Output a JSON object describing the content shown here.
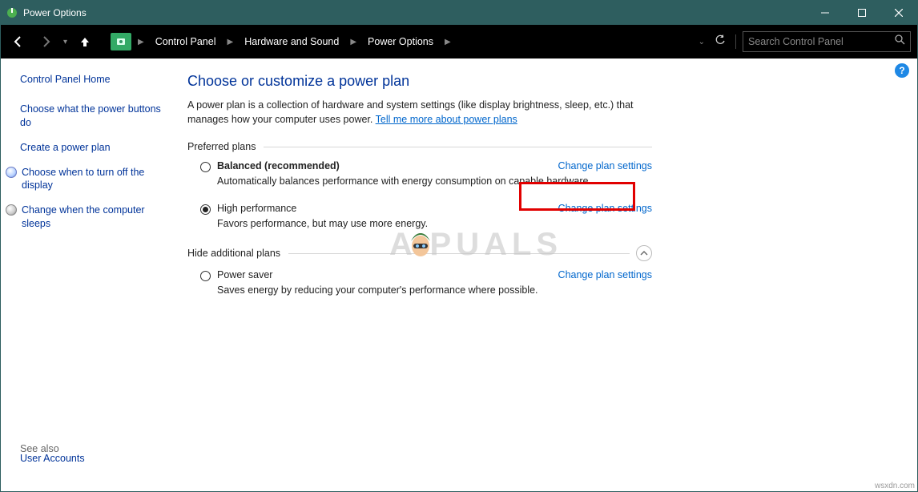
{
  "window": {
    "title": "Power Options"
  },
  "search": {
    "placeholder": "Search Control Panel"
  },
  "breadcrumb": {
    "a": "Control Panel",
    "b": "Hardware and Sound",
    "c": "Power Options"
  },
  "sidebar": {
    "home": "Control Panel Home",
    "choose_buttons": "Choose what the power buttons do",
    "create_plan": "Create a power plan",
    "turn_off_display": "Choose when to turn off the display",
    "when_sleeps": "Change when the computer sleeps",
    "see_also": "See also",
    "user_accounts": "User Accounts"
  },
  "main": {
    "heading": "Choose or customize a power plan",
    "desc_pre": "A power plan is a collection of hardware and system settings (like display brightness, sleep, etc.) that manages how your computer uses power. ",
    "desc_link": "Tell me more about power plans",
    "preferred": "Preferred plans",
    "hide": "Hide additional plans",
    "change_link": "Change plan settings",
    "plans": {
      "balanced_name": "Balanced (recommended)",
      "balanced_desc": "Automatically balances performance with energy consumption on capable hardware.",
      "high_name": "High performance",
      "high_desc": "Favors performance, but may use more energy.",
      "saver_name": "Power saver",
      "saver_desc": "Saves energy by reducing your computer's performance where possible."
    }
  },
  "watermark": "A   PUALS",
  "attrib": "wsxdn.com"
}
